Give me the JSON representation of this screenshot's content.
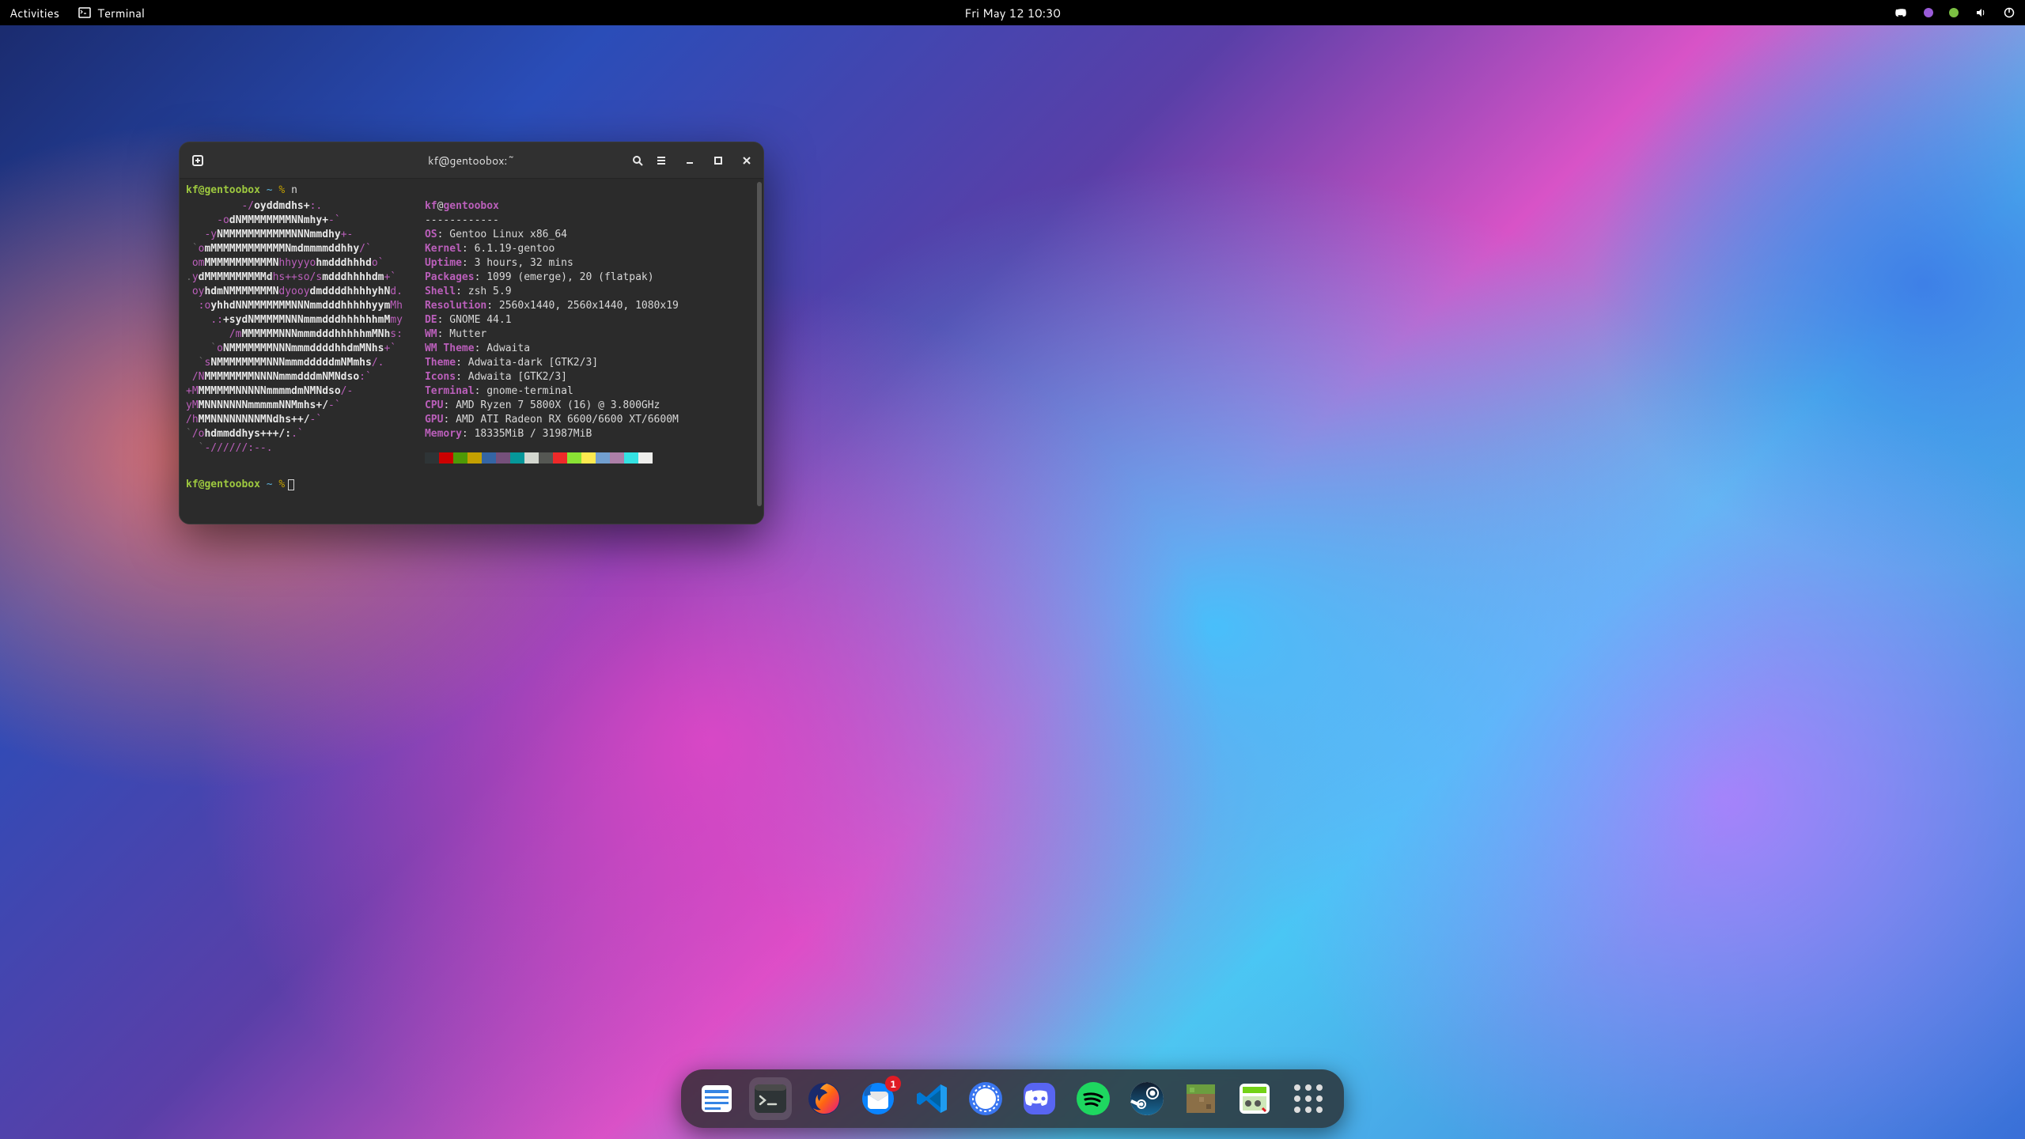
{
  "topbar": {
    "activities_label": "Activities",
    "app_indicator_label": "Terminal",
    "clock": "Fri May 12  10:30",
    "tray": {
      "discord_icon": "discord",
      "dot1_color": "#9a5bd8",
      "dot2_color": "#7bc043",
      "volume_icon": "volume",
      "power_icon": "power"
    }
  },
  "terminal": {
    "title": "kf@gentoobox:~",
    "prompt_user": "kf@gentoobox",
    "prompt_path": "~",
    "prompt_symbol": "%",
    "command": "n",
    "cursor_prompt_user": "kf@gentoobox",
    "ascii_lines": [
      {
        "pre": "         ",
        "m": "-/",
        "w": "oyddmdhs+",
        "m2": ":.",
        "post": ""
      },
      {
        "pre": "     ",
        "m": "-o",
        "w": "dNMMMMMMMMNNmhy+",
        "m2": "",
        "post": "-`"
      },
      {
        "pre": "   ",
        "m": "-y",
        "w": "NMMMMMMMMMMMNNNmmdhy",
        "m2": "",
        "post": "+-"
      },
      {
        "pre": " `",
        "m": "o",
        "w": "mMMMMMMMMMMMMNmdmmmmddhhy",
        "m2": "",
        "post": "/`"
      },
      {
        "pre": " ",
        "m": "om",
        "w": "MMMMMMMMMMMN",
        "m2": "hhyyyo",
        "w2": "hmdddhhhd",
        "post": "o`"
      },
      {
        "pre": ".",
        "m": "y",
        "w": "dMMMMMMMMMMd",
        "m2": "hs++so/s",
        "w2": "mdddhhhhdm",
        "post": "+`"
      },
      {
        "pre": " ",
        "m": "oy",
        "w": "hdmNMMMMMMMN",
        "m2": "dyooy",
        "w2": "dmddddhhhhyhN",
        "post": "d."
      },
      {
        "pre": "  ",
        "m": ":o",
        "w": "yhhdNNMMMMMMMNNNmmdddhhhhhyym",
        "post": "Mh"
      },
      {
        "pre": "    ",
        "m": ".:",
        "w": "+sydNMMMMMNNNmmmdddhhhhhhmM",
        "post": "my"
      },
      {
        "pre": "       ",
        "m": "/m",
        "w": "MMMMMMNNNmmmdddhhhhhmMNh",
        "post": "s:"
      },
      {
        "pre": "    `",
        "m": "o",
        "w": "NMMMMMMMNNNmmmddddhhdmMNhs",
        "post": "+`"
      },
      {
        "pre": "  `",
        "m": "s",
        "w": "NMMMMMMMMNNNmmmdddddmNMmhs",
        "post": "/."
      },
      {
        "pre": " ",
        "m": "/N",
        "w": "MMMMMMMMNNNNmmmdddmNMNdso",
        "post": ":`"
      },
      {
        "pre": "",
        "m": "+M",
        "w": "MMMMMMNNNNNmmmmdmNMNdso",
        "post": "/-"
      },
      {
        "pre": "",
        "m": "yM",
        "w": "MNNNNNNNmmmmmNNMmhs+/",
        "post": "-`"
      },
      {
        "pre": "",
        "m": "/h",
        "w": "MMNNNNNNNNMNdhs++/",
        "post": "-`"
      },
      {
        "pre": "`",
        "m": "/o",
        "w": "hdmmddhys+++/:",
        "post": ".`"
      },
      {
        "pre": "  `",
        "m": "-//////:--",
        "post": "."
      }
    ],
    "neofetch": {
      "header_user": "kf",
      "header_host": "gentoobox",
      "separator": "------------",
      "rows": [
        {
          "key": "OS",
          "value": "Gentoo Linux x86_64"
        },
        {
          "key": "Kernel",
          "value": "6.1.19-gentoo"
        },
        {
          "key": "Uptime",
          "value": "3 hours, 32 mins"
        },
        {
          "key": "Packages",
          "value": "1099 (emerge), 20 (flatpak)"
        },
        {
          "key": "Shell",
          "value": "zsh 5.9"
        },
        {
          "key": "Resolution",
          "value": "2560x1440, 2560x1440, 1080x19"
        },
        {
          "key": "DE",
          "value": "GNOME 44.1"
        },
        {
          "key": "WM",
          "value": "Mutter"
        },
        {
          "key": "WM Theme",
          "value": "Adwaita"
        },
        {
          "key": "Theme",
          "value": "Adwaita-dark [GTK2/3]"
        },
        {
          "key": "Icons",
          "value": "Adwaita [GTK2/3]"
        },
        {
          "key": "Terminal",
          "value": "gnome-terminal"
        },
        {
          "key": "CPU",
          "value": "AMD Ryzen 7 5800X (16) @ 3.800GHz"
        },
        {
          "key": "GPU",
          "value": "AMD ATI Radeon RX 6600/6600 XT/6600M"
        },
        {
          "key": "Memory",
          "value": "18335MiB / 31987MiB"
        }
      ],
      "swatches": [
        "#2e3436",
        "#cc0000",
        "#4e9a06",
        "#c4a000",
        "#3465a4",
        "#75507b",
        "#06989a",
        "#d3d7cf",
        "#555753",
        "#ef2929",
        "#8ae234",
        "#fce94f",
        "#729fcf",
        "#ad7fa8",
        "#34e2e2",
        "#eeeeec"
      ]
    }
  },
  "dock": {
    "items": [
      {
        "name": "files",
        "bg": "#ffffff",
        "accent": "#3584e4",
        "badge": null
      },
      {
        "name": "terminal",
        "bg": "#2e3436",
        "accent": "#888a85",
        "badge": null,
        "active": true
      },
      {
        "name": "firefox",
        "bg": "transparent",
        "badge": null
      },
      {
        "name": "thunderbird",
        "bg": "transparent",
        "badge": "1"
      },
      {
        "name": "vscode",
        "bg": "transparent",
        "badge": null
      },
      {
        "name": "signal",
        "bg": "#3a76f0",
        "badge": null
      },
      {
        "name": "discord",
        "bg": "#5865f2",
        "badge": null
      },
      {
        "name": "spotify",
        "bg": "#1ed760",
        "badge": null
      },
      {
        "name": "steam",
        "bg": "#ffffff",
        "badge": null
      },
      {
        "name": "prism-launcher",
        "bg": "#8b6f47",
        "badge": null
      },
      {
        "name": "gpu-tool",
        "bg": "#73d216",
        "badge": null
      },
      {
        "name": "app-grid",
        "bg": "transparent",
        "badge": null
      }
    ]
  }
}
